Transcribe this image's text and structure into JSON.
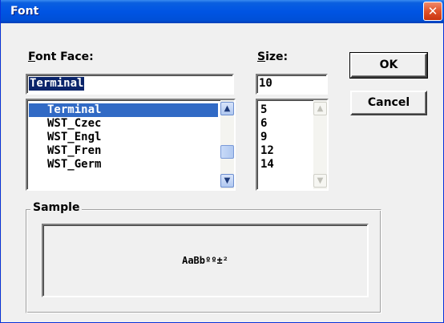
{
  "window": {
    "title": "Font",
    "close_symbol": "✕"
  },
  "font_face": {
    "label_accel": "F",
    "label_rest": "ont Face:",
    "value": "Terminal",
    "items": [
      "Terminal",
      "WST_Czec",
      "WST_Engl",
      "WST_Fren",
      "WST_Germ"
    ],
    "selected_index": 0
  },
  "size": {
    "label_accel": "S",
    "label_rest": "ize:",
    "value": "10",
    "items": [
      "5",
      "6",
      "9",
      "12",
      "14"
    ]
  },
  "buttons": {
    "ok": "OK",
    "cancel": "Cancel"
  },
  "sample": {
    "label": "Sample",
    "text": "AaBbºº±²"
  },
  "icons": {
    "scroll_up": "▲",
    "scroll_down": "▼"
  },
  "colors": {
    "titlebar": "#0054e3",
    "selection": "#316ac5",
    "close": "#e0522a"
  }
}
